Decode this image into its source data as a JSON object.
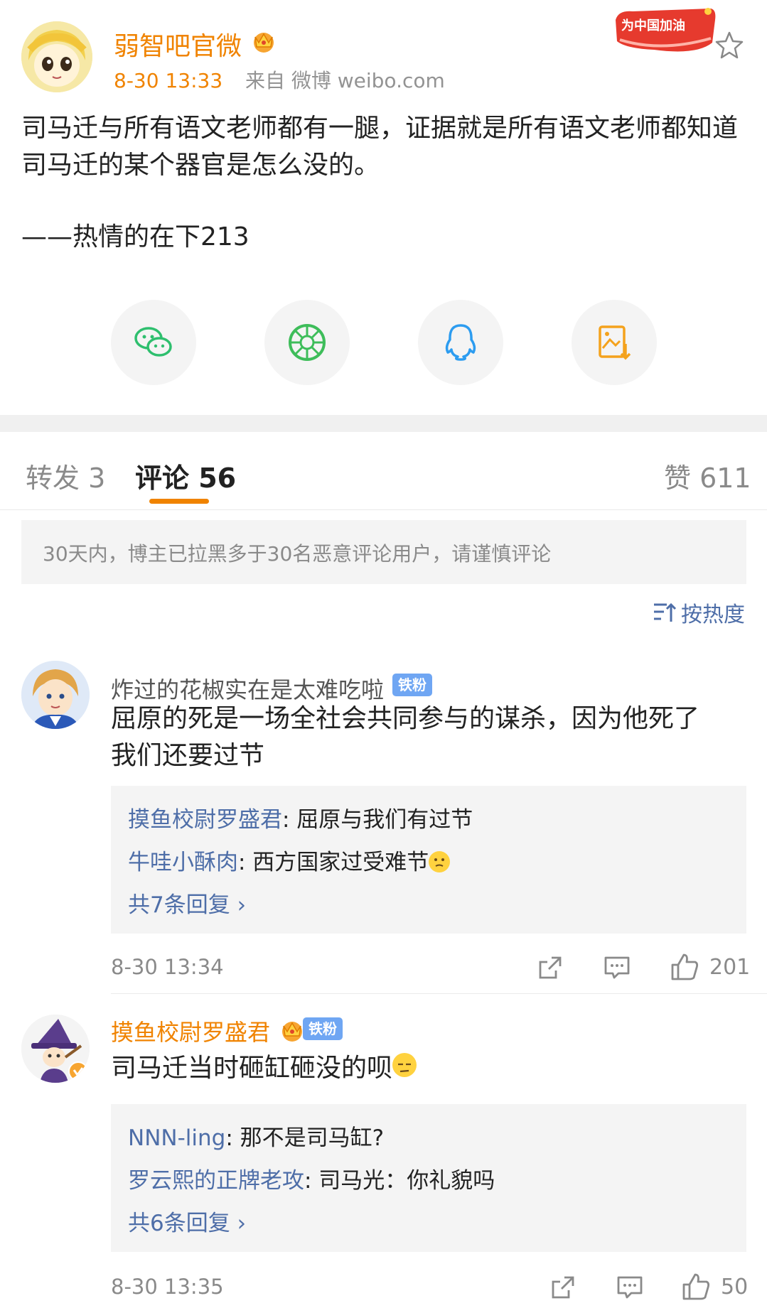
{
  "post": {
    "author": "弱智吧官微",
    "time": "8-30 13:33",
    "source": "来自 微博 weibo.com",
    "promo_badge": "为中国加油",
    "body": "司马迁与所有语文老师都有一腿，证据就是所有语文老师都知道司马迁的某个器官是怎么没的。",
    "signature": "——热情的在下213",
    "share_icons": [
      "wechat-icon",
      "moments-icon",
      "qq-icon",
      "save-image-icon"
    ]
  },
  "tabs": {
    "repost": "转发 3",
    "comments": "评论 56",
    "likes": "赞 611"
  },
  "notice": "30天内，博主已拉黑多于30名恶意评论用户，请谨慎评论",
  "sort_label": "按热度",
  "comments": [
    {
      "user": "炸过的花椒实在是太难吃啦",
      "badge": "铁粉",
      "text_line1": "屈原的死是一场全社会共同参与的谋杀，因为他死了",
      "text_line2": "我们还要过节",
      "replies": [
        {
          "user": "摸鱼校尉罗盛君",
          "text": ": 屈原与我们有过节"
        },
        {
          "user": "牛哇小酥肉",
          "text": ": 西方国家过受难节"
        }
      ],
      "more": "共7条回复 ›",
      "time": "8-30 13:34",
      "likes": "201"
    },
    {
      "user": "摸鱼校尉罗盛君",
      "badge": "铁粉",
      "text_line1": "司马迁当时砸缸砸没的呗",
      "replies": [
        {
          "user": "NNN-ling",
          "text": ": 那不是司马缸?"
        },
        {
          "user": "罗云熙的正牌老攻",
          "text": ": 司马光：你礼貌吗"
        }
      ],
      "more": "共6条回复 ›",
      "time": "8-30 13:35",
      "likes": "50"
    }
  ],
  "colors": {
    "accent": "#f08300",
    "link": "#4e6ea8",
    "muted": "#8a8a8a",
    "badge": "#6fa6f3"
  }
}
